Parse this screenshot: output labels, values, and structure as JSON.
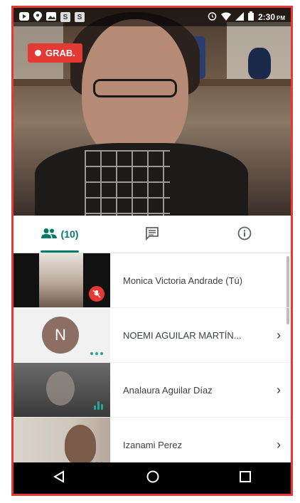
{
  "status_bar": {
    "left_icons": [
      "youtube-icon",
      "location-icon",
      "gallery-icon",
      "s-app-icon",
      "s-app-icon"
    ],
    "s_label": "S",
    "right_icons": [
      "alarm-icon",
      "wifi-icon",
      "signal-icon",
      "battery-icon"
    ],
    "time": "2:30",
    "ampm": "PM"
  },
  "recording": {
    "label": "GRAB.",
    "color": "#e53935"
  },
  "tabs": [
    {
      "id": "people",
      "icon": "people-icon",
      "label": "(10)",
      "active": true
    },
    {
      "id": "chat",
      "icon": "chat-icon",
      "label": "",
      "active": false
    },
    {
      "id": "info",
      "icon": "info-icon",
      "label": "",
      "active": false
    }
  ],
  "participants": [
    {
      "name": "Monica Victoria Andrade (Tú)",
      "indicator": "muted",
      "has_chevron": false
    },
    {
      "name": "NOEMI AGUILAR MARTÍN...",
      "avatar_letter": "N",
      "indicator": "dots",
      "has_chevron": true
    },
    {
      "name": "Analaura Aguilar Díaz",
      "indicator": "speaking",
      "has_chevron": true
    },
    {
      "name": "Izanami Perez",
      "indicator": "dots",
      "has_chevron": true
    }
  ],
  "chevron": "›",
  "accent_color": "#00796b",
  "nav_buttons": [
    "back-icon",
    "home-icon",
    "recents-icon"
  ]
}
